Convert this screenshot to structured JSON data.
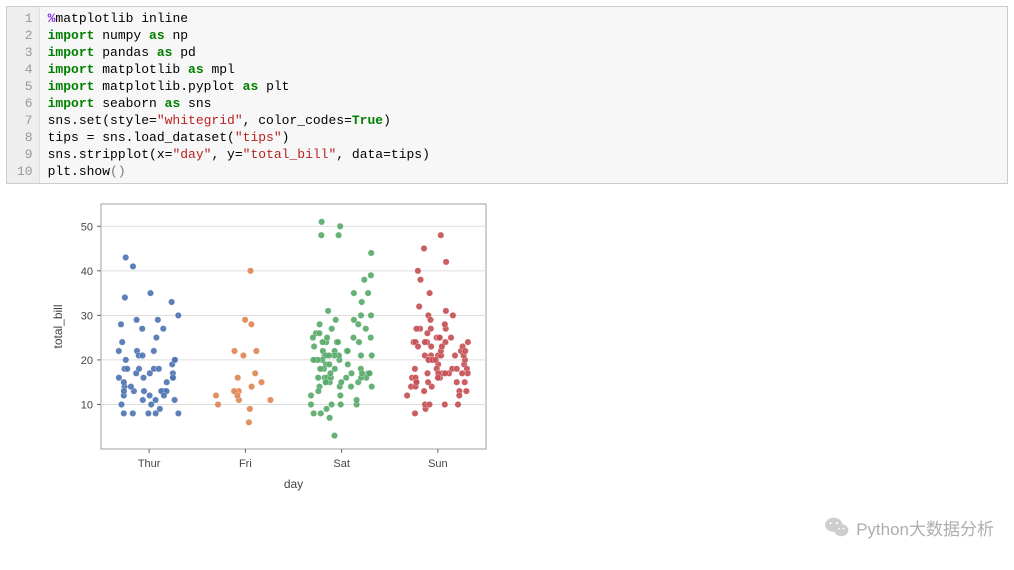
{
  "code": {
    "lines": [
      {
        "n": "1",
        "tokens": [
          {
            "t": "%",
            "c": "k-magic"
          },
          {
            "t": "matplotlib inline",
            "c": ""
          }
        ]
      },
      {
        "n": "2",
        "tokens": [
          {
            "t": "import",
            "c": "k-green"
          },
          {
            "t": " numpy ",
            "c": ""
          },
          {
            "t": "as",
            "c": "k-green"
          },
          {
            "t": " np",
            "c": ""
          }
        ]
      },
      {
        "n": "3",
        "tokens": [
          {
            "t": "import",
            "c": "k-green"
          },
          {
            "t": " pandas ",
            "c": ""
          },
          {
            "t": "as",
            "c": "k-green"
          },
          {
            "t": " pd",
            "c": ""
          }
        ]
      },
      {
        "n": "4",
        "tokens": [
          {
            "t": "import",
            "c": "k-green"
          },
          {
            "t": " matplotlib ",
            "c": ""
          },
          {
            "t": "as",
            "c": "k-green"
          },
          {
            "t": " mpl",
            "c": ""
          }
        ]
      },
      {
        "n": "5",
        "tokens": [
          {
            "t": "import",
            "c": "k-green"
          },
          {
            "t": " matplotlib.pyplot ",
            "c": ""
          },
          {
            "t": "as",
            "c": "k-green"
          },
          {
            "t": " plt",
            "c": ""
          }
        ]
      },
      {
        "n": "6",
        "tokens": [
          {
            "t": "import",
            "c": "k-green"
          },
          {
            "t": " seaborn ",
            "c": ""
          },
          {
            "t": "as",
            "c": "k-green"
          },
          {
            "t": " sns",
            "c": ""
          }
        ]
      },
      {
        "n": "7",
        "tokens": [
          {
            "t": "sns.set(style=",
            "c": ""
          },
          {
            "t": "\"whitegrid\"",
            "c": "k-str"
          },
          {
            "t": ", color_codes=",
            "c": ""
          },
          {
            "t": "True",
            "c": "k-bool"
          },
          {
            "t": ")",
            "c": ""
          }
        ]
      },
      {
        "n": "8",
        "tokens": [
          {
            "t": "tips = sns.load_dataset(",
            "c": ""
          },
          {
            "t": "\"tips\"",
            "c": "k-str"
          },
          {
            "t": ")",
            "c": ""
          }
        ]
      },
      {
        "n": "9",
        "tokens": [
          {
            "t": "sns.stripplot(x=",
            "c": ""
          },
          {
            "t": "\"day\"",
            "c": "k-str"
          },
          {
            "t": ", y=",
            "c": ""
          },
          {
            "t": "\"total_bill\"",
            "c": "k-str"
          },
          {
            "t": ", data=tips)",
            "c": ""
          }
        ]
      },
      {
        "n": "10",
        "tokens": [
          {
            "t": "plt.show",
            "c": ""
          },
          {
            "t": "()",
            "c": "paren"
          }
        ]
      }
    ]
  },
  "chart_data": {
    "type": "strip",
    "xlabel": "day",
    "ylabel": "total_bill",
    "categories": [
      "Thur",
      "Fri",
      "Sat",
      "Sun"
    ],
    "ylim": [
      0,
      55
    ],
    "yticks": [
      10,
      20,
      30,
      40,
      50
    ],
    "colors": {
      "Thur": "#4c72b0",
      "Fri": "#dd8452",
      "Sat": "#55a868",
      "Sun": "#c44e52"
    },
    "series": [
      {
        "name": "Thur",
        "values": [
          27,
          22,
          16,
          10,
          20,
          17,
          13,
          10,
          16,
          22,
          15,
          19,
          18,
          13,
          13,
          24,
          21,
          29,
          11,
          8,
          8,
          18,
          12,
          8,
          14,
          15,
          11,
          16,
          21,
          13,
          20,
          13,
          12,
          25,
          18,
          17,
          11,
          17,
          14,
          9,
          30,
          22,
          33,
          28,
          18,
          27,
          20,
          8,
          18,
          16,
          8,
          13,
          12,
          29,
          34,
          35,
          41,
          43
        ]
      },
      {
        "name": "Fri",
        "values": [
          28,
          17,
          10,
          13,
          11,
          12,
          9,
          22,
          22,
          6,
          11,
          12,
          15,
          21,
          40,
          14,
          13,
          16,
          29
        ]
      },
      {
        "name": "Sat",
        "values": [
          20,
          10,
          21,
          24,
          25,
          8,
          27,
          15,
          15,
          18,
          10,
          38,
          24,
          22,
          14,
          14,
          7,
          21,
          22,
          11,
          19,
          16,
          17,
          9,
          16,
          31,
          16,
          24,
          18,
          19,
          17,
          28,
          15,
          20,
          10,
          33,
          16,
          17,
          20,
          21,
          26,
          25,
          16,
          48,
          12,
          14,
          10,
          21,
          29,
          12,
          21,
          35,
          22,
          20,
          44,
          15,
          20,
          25,
          18,
          24,
          16,
          39,
          30,
          48,
          21,
          30,
          28,
          24,
          13,
          29,
          22,
          17,
          14,
          15,
          16,
          8,
          26,
          25,
          19,
          35,
          18,
          17,
          27,
          21,
          23,
          50,
          51,
          3
        ]
      },
      {
        "name": "Sun",
        "values": [
          17,
          10,
          21,
          24,
          25,
          9,
          27,
          15,
          15,
          14,
          10,
          35,
          16,
          19,
          20,
          17,
          10,
          16,
          13,
          18,
          24,
          21,
          13,
          16,
          8,
          22,
          20,
          38,
          24,
          25,
          18,
          21,
          23,
          15,
          20,
          17,
          24,
          30,
          40,
          27,
          14,
          17,
          13,
          18,
          21,
          24,
          22,
          17,
          21,
          12,
          10,
          12,
          19,
          20,
          21,
          18,
          22,
          14,
          15,
          23,
          25,
          17,
          27,
          45,
          23,
          48,
          16,
          20,
          30,
          18,
          24,
          42,
          28,
          25,
          31,
          26,
          20,
          27,
          29,
          32,
          17,
          23,
          15
        ]
      }
    ]
  },
  "watermark": {
    "text": "Python大数据分析"
  }
}
